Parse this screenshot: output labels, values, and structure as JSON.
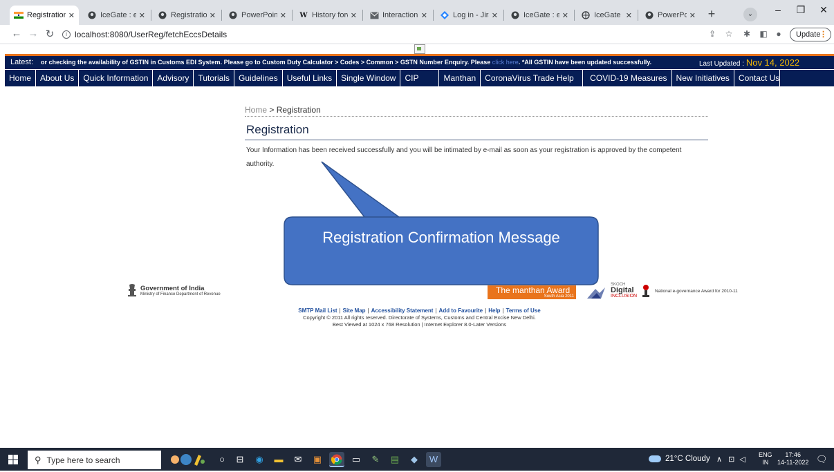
{
  "browser": {
    "tabs": [
      {
        "title": "Registration",
        "favicon": "india-flag-icon",
        "active": true
      },
      {
        "title": "IceGate : e-C",
        "favicon": "icegate-icon"
      },
      {
        "title": "Registration",
        "favicon": "icegate-icon"
      },
      {
        "title": "PowerPoint F",
        "favicon": "icegate-icon"
      },
      {
        "title": "History forw",
        "favicon": "wiki-icon"
      },
      {
        "title": "Interaction S",
        "favicon": "mail-icon"
      },
      {
        "title": "Log in - Jira",
        "favicon": "jira-icon"
      },
      {
        "title": "IceGate : e-C",
        "favicon": "icegate-icon"
      },
      {
        "title": "IceGate : e-C",
        "favicon": "globe-icon"
      },
      {
        "title": "PowerPoint F",
        "favicon": "icegate-icon"
      }
    ],
    "new_tab": "+",
    "url": "localhost:8080/UserReg/fetchEccsDetails",
    "update_label": "Update"
  },
  "ticker": {
    "latest_label": "Latest:",
    "message": "or checking the availability of GSTIN in Customs EDI System. Please go to Custom Duty Calculator > Codes > Common > GSTN Number Enquiry. Please",
    "link_text": "click here",
    "message_tail": ".    *All GSTIN have been updated successfully.",
    "updated_label": "Last Updated :",
    "updated_date": "Nov 14, 2022"
  },
  "nav": [
    "Home",
    "About Us",
    "Quick Information",
    "Advisory",
    "Tutorials",
    "Guidelines",
    "Useful Links",
    "Single Window",
    "CIP",
    "Manthan",
    "CoronaVirus Trade Help",
    "COVID-19 Measures",
    "New Initiatives",
    "Contact Us"
  ],
  "breadcrumb": {
    "home": "Home",
    "sep": ">",
    "current": "Registration"
  },
  "page_title": "Registration",
  "message": "Your Information has been received successfully and you will be intimated by e-mail as soon as your registration is approved by the competent authority.",
  "callout": "Registration Confirmation Message",
  "footer": {
    "goi_title": "Government of India",
    "goi_sub": "Ministry of Finance Department of Revenue",
    "manthan_award": "The manthan Award",
    "manthan_sub": "South Asia 2011",
    "skoch_top": "SKOCH",
    "skoch_main": "Digital",
    "skoch_inc": "INCLUSION",
    "national_award": "National e-governance Award for 2010-11",
    "links": [
      "SMTP Mail List",
      "Site Map",
      "Accessibility Statement",
      "Add to Favourite",
      "Help",
      "Terms of Use"
    ],
    "copyright": "Copyright © 2011 All rights reserved. Directorate of Systems, Customs and Central Excise New Delhi.",
    "best_viewed": "Best Viewed at 1024 x 768 Resolution | Internet Explorer 8.0-Later Versions"
  },
  "taskbar": {
    "search_placeholder": "Type here to search",
    "weather": "21°C  Cloudy",
    "lang_top": "ENG",
    "lang_bottom": "IN",
    "time": "17:46",
    "date": "14-11-2022"
  }
}
